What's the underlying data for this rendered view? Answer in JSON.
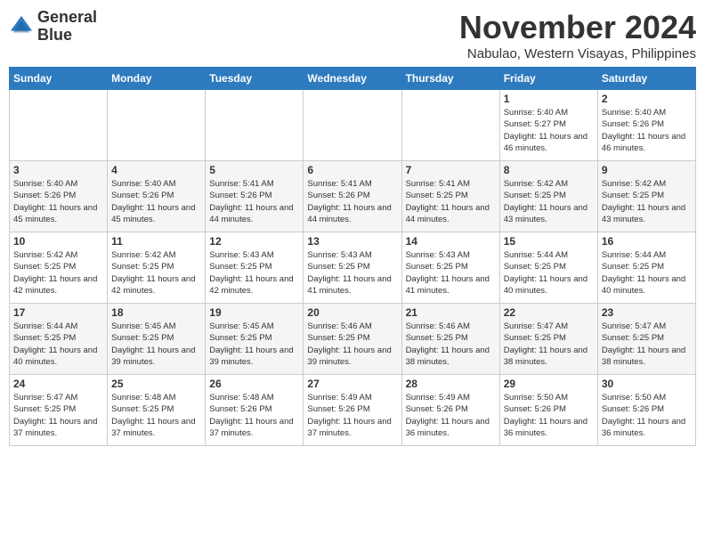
{
  "header": {
    "logo_line1": "General",
    "logo_line2": "Blue",
    "month_year": "November 2024",
    "location": "Nabulao, Western Visayas, Philippines"
  },
  "weekdays": [
    "Sunday",
    "Monday",
    "Tuesday",
    "Wednesday",
    "Thursday",
    "Friday",
    "Saturday"
  ],
  "weeks": [
    [
      {
        "day": "",
        "empty": true
      },
      {
        "day": "",
        "empty": true
      },
      {
        "day": "",
        "empty": true
      },
      {
        "day": "",
        "empty": true
      },
      {
        "day": "",
        "empty": true
      },
      {
        "day": "1",
        "sunrise": "5:40 AM",
        "sunset": "5:27 PM",
        "daylight": "11 hours and 46 minutes."
      },
      {
        "day": "2",
        "sunrise": "5:40 AM",
        "sunset": "5:26 PM",
        "daylight": "11 hours and 46 minutes."
      }
    ],
    [
      {
        "day": "3",
        "sunrise": "5:40 AM",
        "sunset": "5:26 PM",
        "daylight": "11 hours and 45 minutes."
      },
      {
        "day": "4",
        "sunrise": "5:40 AM",
        "sunset": "5:26 PM",
        "daylight": "11 hours and 45 minutes."
      },
      {
        "day": "5",
        "sunrise": "5:41 AM",
        "sunset": "5:26 PM",
        "daylight": "11 hours and 44 minutes."
      },
      {
        "day": "6",
        "sunrise": "5:41 AM",
        "sunset": "5:26 PM",
        "daylight": "11 hours and 44 minutes."
      },
      {
        "day": "7",
        "sunrise": "5:41 AM",
        "sunset": "5:25 PM",
        "daylight": "11 hours and 44 minutes."
      },
      {
        "day": "8",
        "sunrise": "5:42 AM",
        "sunset": "5:25 PM",
        "daylight": "11 hours and 43 minutes."
      },
      {
        "day": "9",
        "sunrise": "5:42 AM",
        "sunset": "5:25 PM",
        "daylight": "11 hours and 43 minutes."
      }
    ],
    [
      {
        "day": "10",
        "sunrise": "5:42 AM",
        "sunset": "5:25 PM",
        "daylight": "11 hours and 42 minutes."
      },
      {
        "day": "11",
        "sunrise": "5:42 AM",
        "sunset": "5:25 PM",
        "daylight": "11 hours and 42 minutes."
      },
      {
        "day": "12",
        "sunrise": "5:43 AM",
        "sunset": "5:25 PM",
        "daylight": "11 hours and 42 minutes."
      },
      {
        "day": "13",
        "sunrise": "5:43 AM",
        "sunset": "5:25 PM",
        "daylight": "11 hours and 41 minutes."
      },
      {
        "day": "14",
        "sunrise": "5:43 AM",
        "sunset": "5:25 PM",
        "daylight": "11 hours and 41 minutes."
      },
      {
        "day": "15",
        "sunrise": "5:44 AM",
        "sunset": "5:25 PM",
        "daylight": "11 hours and 40 minutes."
      },
      {
        "day": "16",
        "sunrise": "5:44 AM",
        "sunset": "5:25 PM",
        "daylight": "11 hours and 40 minutes."
      }
    ],
    [
      {
        "day": "17",
        "sunrise": "5:44 AM",
        "sunset": "5:25 PM",
        "daylight": "11 hours and 40 minutes."
      },
      {
        "day": "18",
        "sunrise": "5:45 AM",
        "sunset": "5:25 PM",
        "daylight": "11 hours and 39 minutes."
      },
      {
        "day": "19",
        "sunrise": "5:45 AM",
        "sunset": "5:25 PM",
        "daylight": "11 hours and 39 minutes."
      },
      {
        "day": "20",
        "sunrise": "5:46 AM",
        "sunset": "5:25 PM",
        "daylight": "11 hours and 39 minutes."
      },
      {
        "day": "21",
        "sunrise": "5:46 AM",
        "sunset": "5:25 PM",
        "daylight": "11 hours and 38 minutes."
      },
      {
        "day": "22",
        "sunrise": "5:47 AM",
        "sunset": "5:25 PM",
        "daylight": "11 hours and 38 minutes."
      },
      {
        "day": "23",
        "sunrise": "5:47 AM",
        "sunset": "5:25 PM",
        "daylight": "11 hours and 38 minutes."
      }
    ],
    [
      {
        "day": "24",
        "sunrise": "5:47 AM",
        "sunset": "5:25 PM",
        "daylight": "11 hours and 37 minutes."
      },
      {
        "day": "25",
        "sunrise": "5:48 AM",
        "sunset": "5:25 PM",
        "daylight": "11 hours and 37 minutes."
      },
      {
        "day": "26",
        "sunrise": "5:48 AM",
        "sunset": "5:26 PM",
        "daylight": "11 hours and 37 minutes."
      },
      {
        "day": "27",
        "sunrise": "5:49 AM",
        "sunset": "5:26 PM",
        "daylight": "11 hours and 37 minutes."
      },
      {
        "day": "28",
        "sunrise": "5:49 AM",
        "sunset": "5:26 PM",
        "daylight": "11 hours and 36 minutes."
      },
      {
        "day": "29",
        "sunrise": "5:50 AM",
        "sunset": "5:26 PM",
        "daylight": "11 hours and 36 minutes."
      },
      {
        "day": "30",
        "sunrise": "5:50 AM",
        "sunset": "5:26 PM",
        "daylight": "11 hours and 36 minutes."
      }
    ]
  ]
}
